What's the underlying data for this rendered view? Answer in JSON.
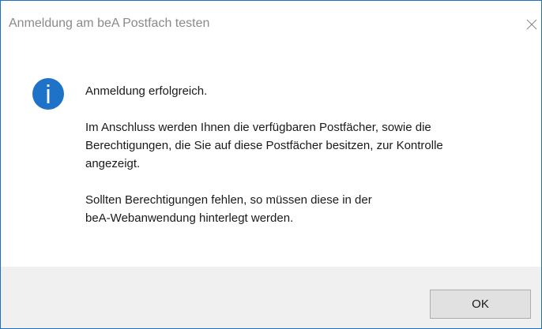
{
  "window": {
    "title": "Anmeldung am beA Postfach testen",
    "close_icon": "close-icon"
  },
  "message": {
    "icon": "info-icon",
    "paragraph_1": "Anmeldung erfolgreich.",
    "paragraph_2_line_1": "Im Anschluss werden Ihnen die verfügbaren Postfächer, sowie die",
    "paragraph_2_line_2": "Berechtigungen, die Sie auf diese Postfächer besitzen, zur Kontrolle",
    "paragraph_2_line_3": "angezeigt.",
    "paragraph_3_line_1": "Sollten Berechtigungen fehlen, so müssen diese in der",
    "paragraph_3_line_2": "beA-Webanwendung hinterlegt werden."
  },
  "buttons": {
    "ok_label": "OK"
  },
  "colors": {
    "window_border": "#1f6fc0",
    "info_icon": "#1e73c9",
    "footer_background": "#f0f0f0"
  }
}
